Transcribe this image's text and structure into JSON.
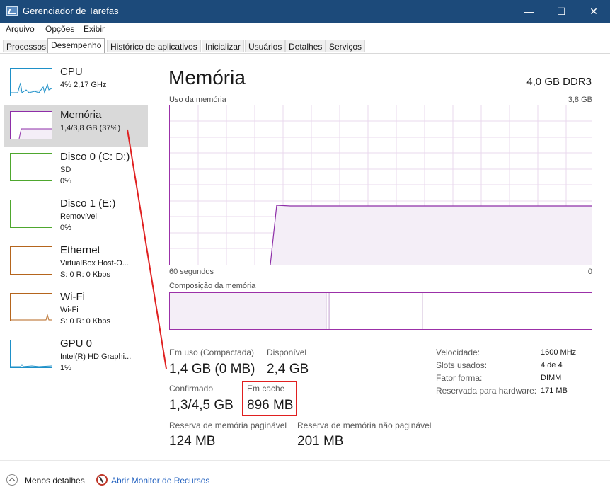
{
  "window": {
    "title": "Gerenciador de Tarefas",
    "controls": {
      "minimize": "—",
      "maximize": "☐",
      "close": "✕"
    }
  },
  "menu": [
    "Arquivo",
    "Opções",
    "Exibir"
  ],
  "tabs": [
    "Processos",
    "Desempenho",
    "Histórico de aplicativos",
    "Inicializar",
    "Usuários",
    "Detalhes",
    "Serviços"
  ],
  "sidebar": {
    "items": [
      {
        "title": "CPU",
        "line1": "4% 2,17 GHz",
        "line2": "",
        "color": "#1e90c8"
      },
      {
        "title": "Memória",
        "line1": "1,4/3,8 GB (37%)",
        "line2": "",
        "color": "#8e2ea8"
      },
      {
        "title": "Disco 0 (C: D:)",
        "line1": "SD",
        "line2": "0%",
        "color": "#4ea72e"
      },
      {
        "title": "Disco 1 (E:)",
        "line1": "Removível",
        "line2": "0%",
        "color": "#4ea72e"
      },
      {
        "title": "Ethernet",
        "line1": "VirtualBox Host-O...",
        "line2": "S: 0 R: 0 Kbps",
        "color": "#b5651d"
      },
      {
        "title": "Wi-Fi",
        "line1": "Wi-Fi",
        "line2": "S: 0 R: 0 Kbps",
        "color": "#b5651d"
      },
      {
        "title": "GPU 0",
        "line1": "Intel(R) HD Graphi...",
        "line2": "1%",
        "color": "#1e90c8"
      }
    ]
  },
  "main": {
    "title": "Memória",
    "spec": "4,0 GB DDR3",
    "usage_label": "Uso da memória",
    "usage_max": "3,8 GB",
    "time_label": "60 segundos",
    "time_end": "0",
    "composition_label": "Composição da memória",
    "stats": {
      "in_use_label": "Em uso (Compactada)",
      "in_use_value": "1,4 GB (0 MB)",
      "available_label": "Disponível",
      "available_value": "2,4 GB",
      "committed_label": "Confirmado",
      "committed_value": "1,3/4,5 GB",
      "cached_label": "Em cache",
      "cached_value": "896 MB",
      "paged_label": "Reserva de memória paginável",
      "paged_value": "124 MB",
      "nonpaged_label": "Reserva de memória não paginável",
      "nonpaged_value": "201 MB"
    },
    "details": [
      {
        "key": "Velocidade:",
        "value": "1600 MHz"
      },
      {
        "key": "Slots usados:",
        "value": "4 de 4"
      },
      {
        "key": "Fator forma:",
        "value": "DIMM"
      },
      {
        "key": "Reservada para hardware:",
        "value": "171 MB"
      }
    ]
  },
  "bottom": {
    "less_details": "Menos detalhes",
    "resource_monitor": "Abrir Monitor de Recursos"
  },
  "colors": {
    "memory": "#8e2ea8",
    "memory_fill": "#f4eef7",
    "annotation": "#e02020",
    "titlebar": "#1c4a7a"
  }
}
